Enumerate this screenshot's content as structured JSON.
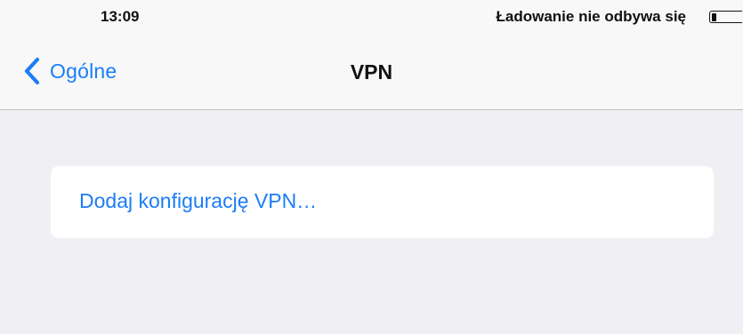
{
  "status_bar": {
    "time": "13:09",
    "charging_status": "Ładowanie nie odbywa się",
    "battery_icon": "battery-low-icon"
  },
  "nav_bar": {
    "back_label": "Ogólne",
    "back_icon": "chevron-left-icon",
    "title": "VPN"
  },
  "vpn_list": {
    "add_configuration_label": "Dodaj konfigurację VPN…"
  },
  "colors": {
    "accent": "#1a7df7",
    "background": "#efeff4",
    "header_background": "#f8f8f8",
    "separator": "#bdbdc1"
  }
}
